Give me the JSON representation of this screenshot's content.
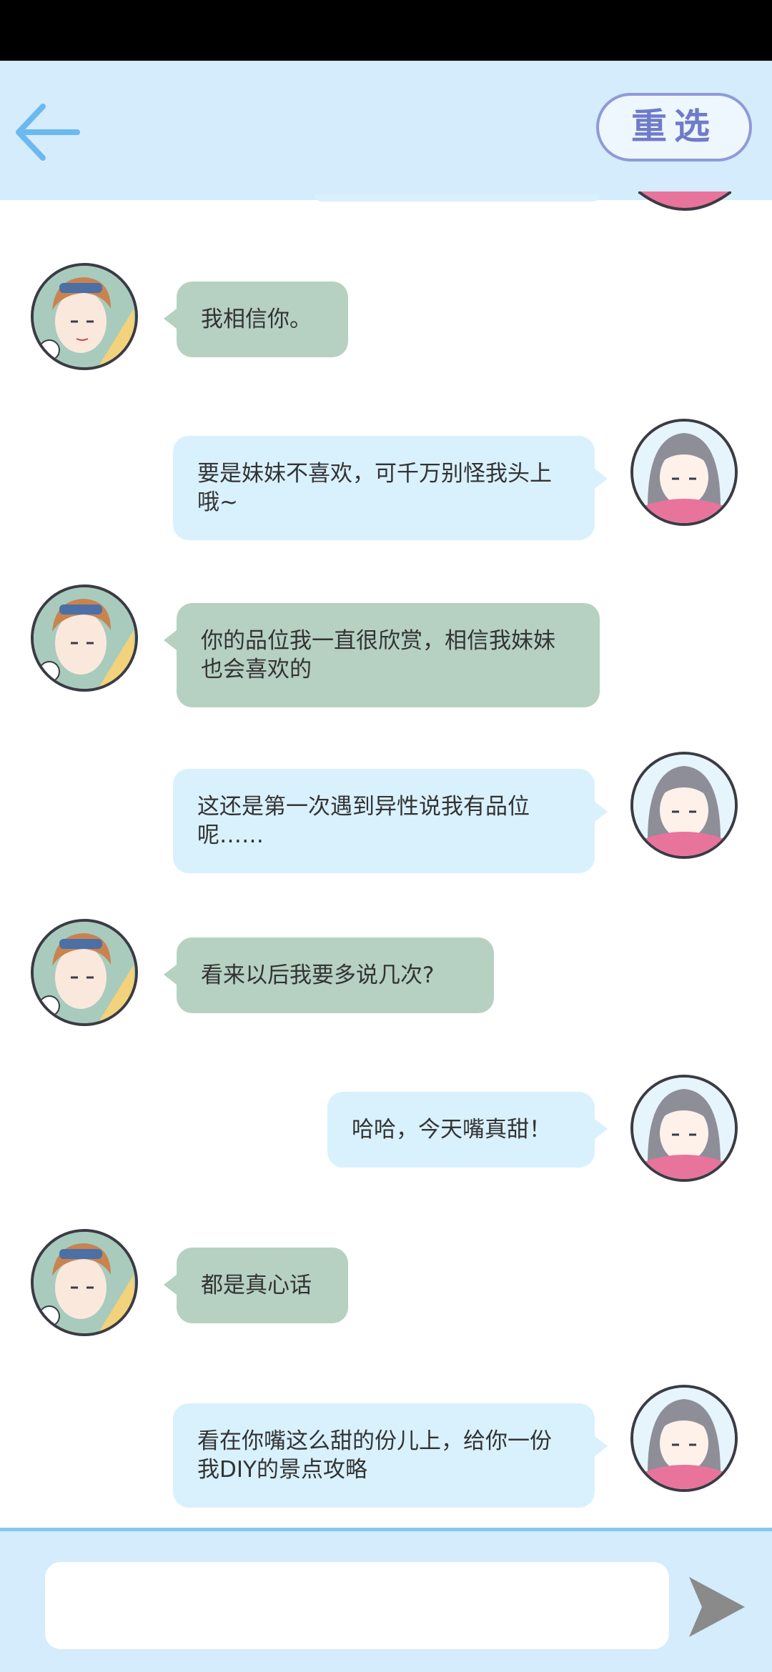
{
  "header": {
    "back_icon": "arrow-left-icon",
    "reselect_label": "重选"
  },
  "messages": [
    {
      "sender": "boy",
      "text": "我相信你。"
    },
    {
      "sender": "girl",
      "text": "要是妹妹不喜欢，可千万别怪我头上哦~"
    },
    {
      "sender": "boy",
      "text": "你的品位我一直很欣赏，相信我妹妹也会喜欢的"
    },
    {
      "sender": "girl",
      "text": "这还是第一次遇到异性说我有品位呢……"
    },
    {
      "sender": "boy",
      "text": "看来以后我要多说几次?"
    },
    {
      "sender": "girl",
      "text": "哈哈，今天嘴真甜！"
    },
    {
      "sender": "boy",
      "text": "都是真心话"
    },
    {
      "sender": "girl",
      "text": "看在你嘴这么甜的份儿上，给你一份我DIY的景点攻略"
    }
  ],
  "composer": {
    "placeholder": "",
    "send_icon": "send-icon"
  },
  "colors": {
    "topbar": "#d4ecfb",
    "boy_bubble": "#b6d1c2",
    "girl_bubble": "#d9f1fd",
    "accent": "#83c7f0"
  }
}
